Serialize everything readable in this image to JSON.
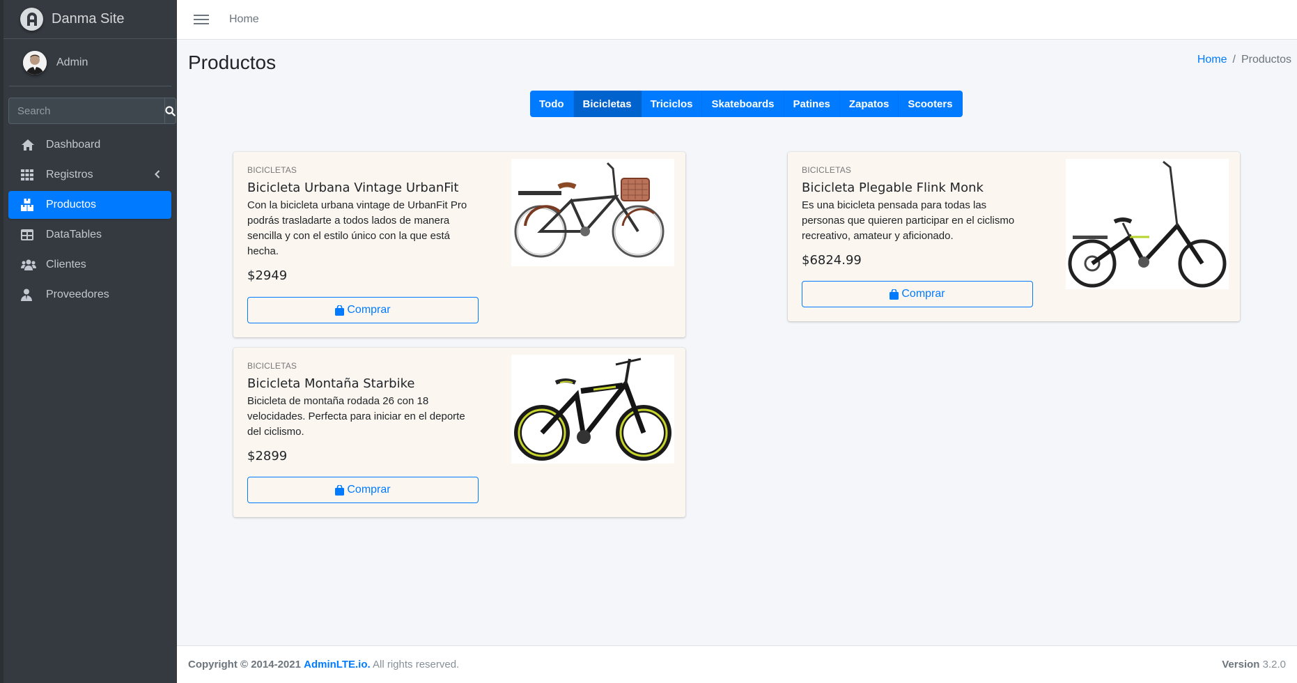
{
  "sidebar": {
    "brand": "Danma Site",
    "user": "Admin",
    "search_placeholder": "Search",
    "items": [
      {
        "label": "Dashboard",
        "icon": "home-icon"
      },
      {
        "label": "Registros",
        "icon": "grid-icon"
      },
      {
        "label": "Productos",
        "icon": "boxes-icon"
      },
      {
        "label": "DataTables",
        "icon": "table-icon"
      },
      {
        "label": "Clientes",
        "icon": "users-icon"
      },
      {
        "label": "Proveedores",
        "icon": "user-tie-icon"
      }
    ]
  },
  "topbar": {
    "home": "Home"
  },
  "page": {
    "title": "Productos",
    "breadcrumb": {
      "home": "Home",
      "current": "Productos"
    }
  },
  "filters": [
    "Todo",
    "Bicicletas",
    "Triciclos",
    "Skateboards",
    "Patines",
    "Zapatos",
    "Scooters"
  ],
  "products": [
    {
      "category": "BICICLETAS",
      "title": "Bicicleta Urbana Vintage UrbanFit",
      "description": "Con la bicicleta urbana vintage de UrbanFit Pro podrás trasladarte a todos lados de manera sencilla y con el estilo único con la que está hecha.",
      "price": "$2949",
      "button": "Comprar"
    },
    {
      "category": "BICICLETAS",
      "title": "Bicicleta Plegable Flink Monk",
      "description": "Es una bicicleta pensada para todas las personas que quieren participar en el ciclismo recreativo, amateur y aficionado.",
      "price": "$6824.99",
      "button": "Comprar"
    },
    {
      "category": "BICICLETAS",
      "title": "Bicicleta Montaña Starbike",
      "description": "Bicicleta de montaña rodada 26 con 18 velocidades. Perfecta para iniciar en el deporte del ciclismo.",
      "price": "$2899",
      "button": "Comprar"
    }
  ],
  "footer": {
    "copyright": "Copyright © 2014-2021",
    "link": "AdminLTE.io.",
    "rights": "All rights reserved.",
    "version_label": "Version",
    "version": "3.2.0"
  },
  "colors": {
    "accent": "#007bff",
    "sidebar": "#343a40",
    "card": "#fbf6f0"
  }
}
